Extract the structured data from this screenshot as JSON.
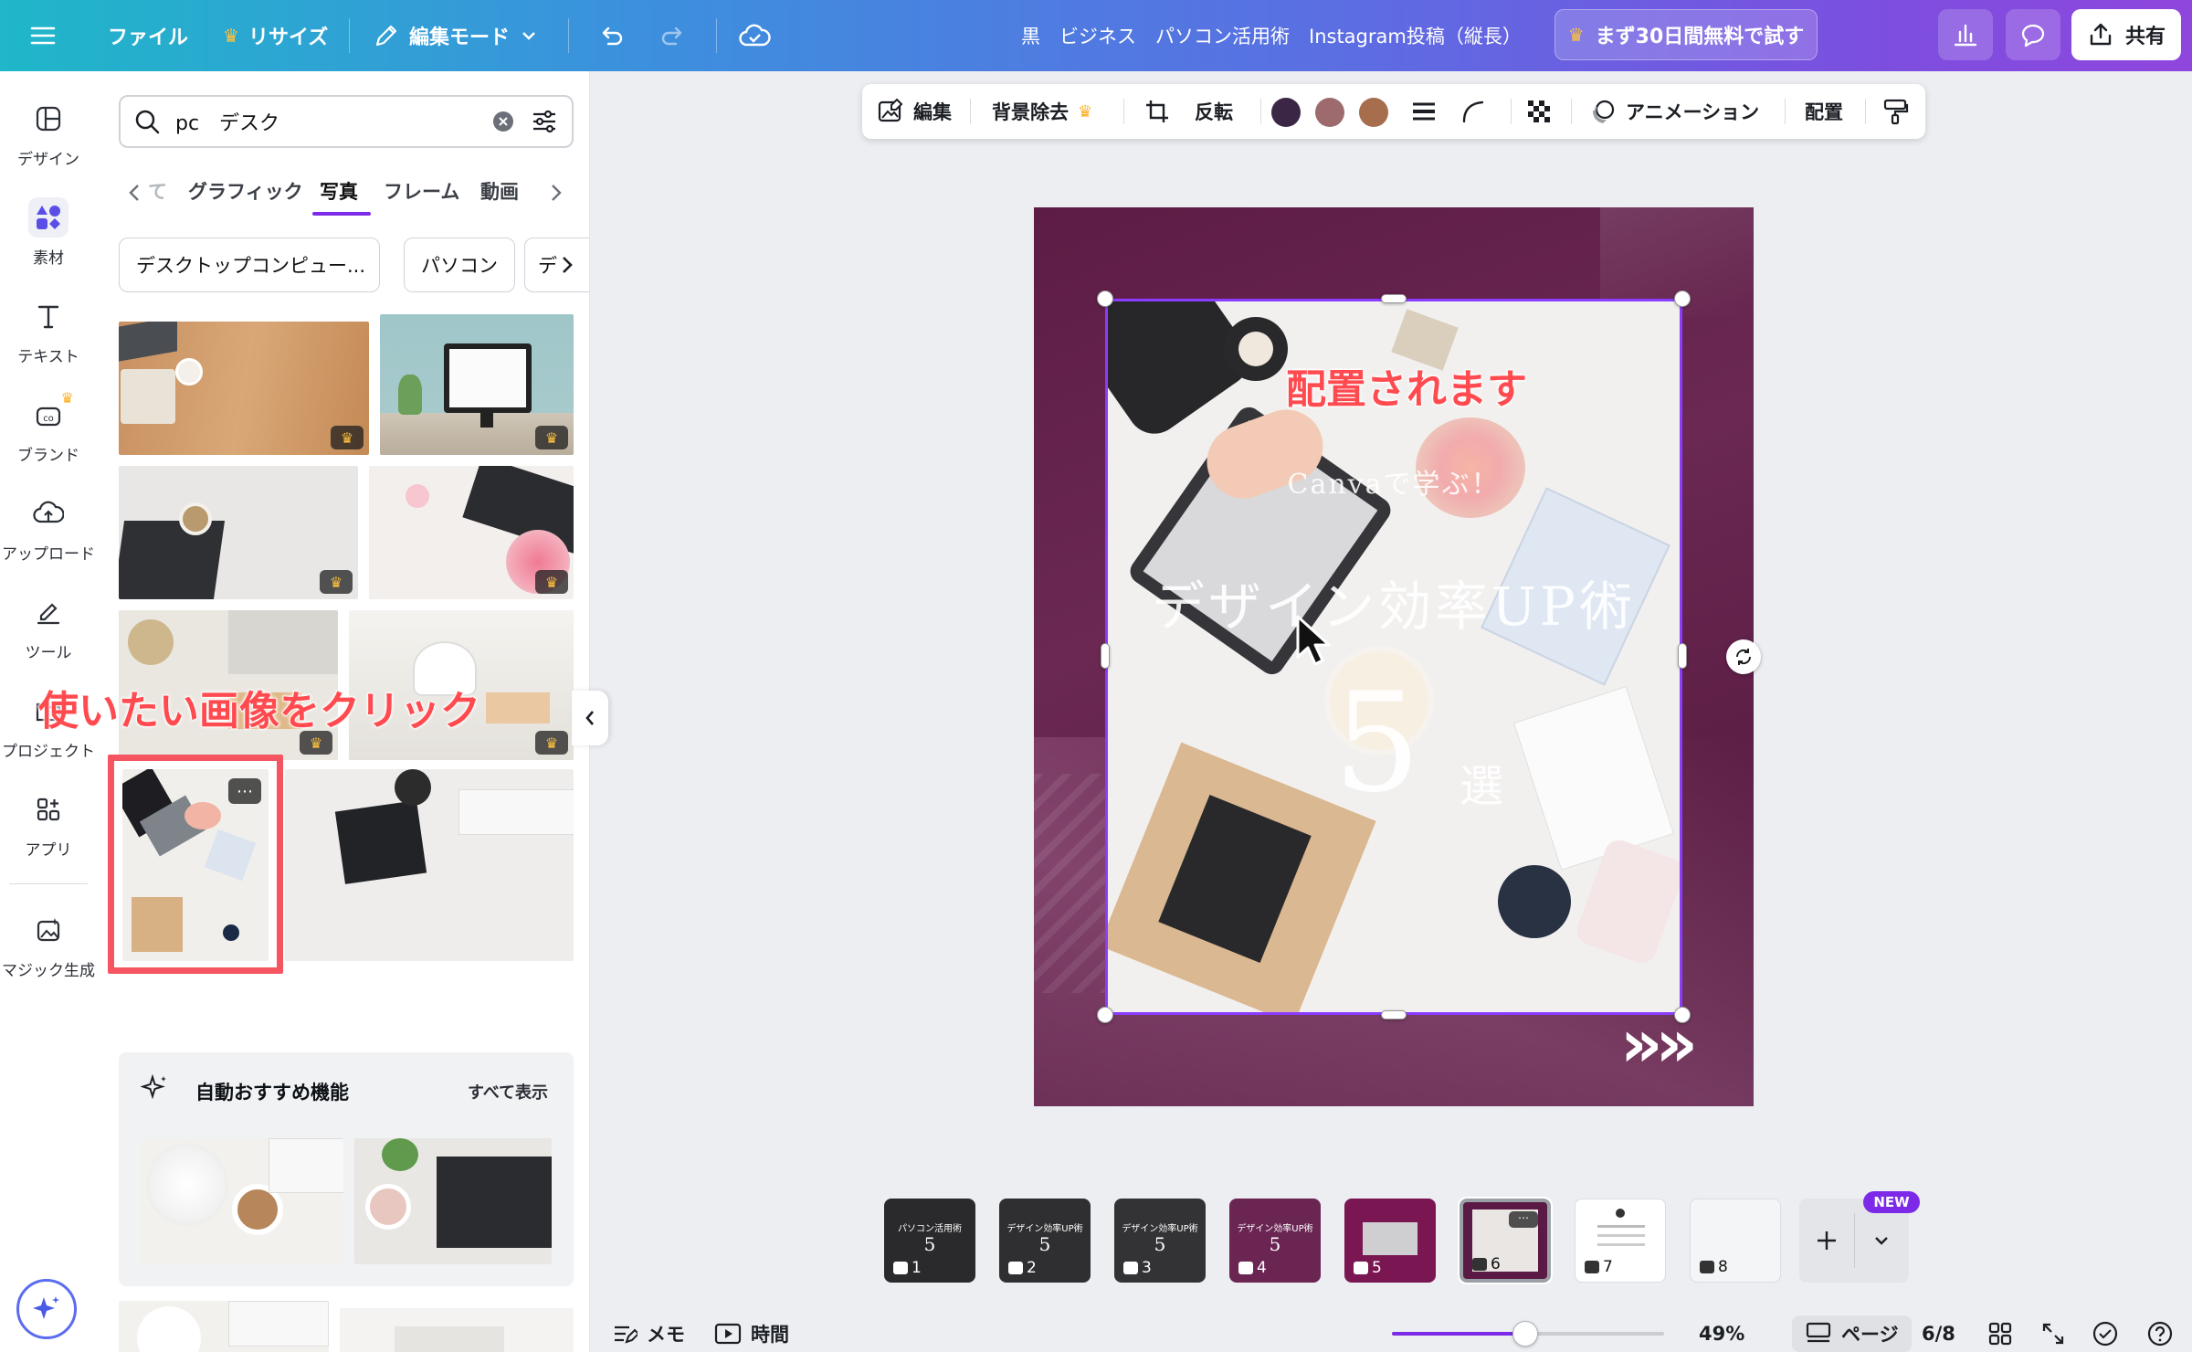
{
  "topbar": {
    "file": "ファイル",
    "resize": "リサイズ",
    "edit_mode": "編集モード",
    "doc_title": "黒　ビジネス　パソコン活用術　Instagram投稿（縦長）",
    "trial": "まず30日間無料で試す",
    "share": "共有"
  },
  "rail": {
    "design": "デザイン",
    "elements": "素材",
    "text": "テキスト",
    "brand": "ブランド",
    "upload": "アップロード",
    "tools": "ツール",
    "projects": "プロジェクト",
    "apps": "アプリ",
    "magic": "マジック生成"
  },
  "panel": {
    "search_value": "pc　デスク",
    "tabs": [
      "て",
      "グラフィック",
      "写真",
      "フレーム",
      "動画"
    ],
    "chips": [
      "デスクトップコンピュー...",
      "パソコン",
      "デ"
    ],
    "rec_title": "自動おすすめ機能",
    "rec_all": "すべて表示"
  },
  "floatbar": {
    "edit": "編集",
    "bg_remove": "背景除去",
    "flip": "反転",
    "animation": "アニメーション",
    "position": "配置",
    "colors": [
      "#3b2646",
      "#9d6b6e",
      "#a66e4d"
    ]
  },
  "canvas": {
    "subtitle": "Canvaで学ぶ！",
    "title": "デザイン効率UP術",
    "number": "5",
    "unit": "選",
    "arrows": "»»",
    "annot_placed": "配置されます",
    "annot_click": "使いたい画像をクリック"
  },
  "pages": {
    "items": [
      "1",
      "2",
      "3",
      "4",
      "5",
      "6",
      "7",
      "8"
    ],
    "new_badge": "NEW",
    "thumb_title": "パソコン活用術",
    "thumb_title2": "デザイン効率UP術",
    "thumb_num": "5"
  },
  "bottombar": {
    "memo": "メモ",
    "time": "時間",
    "zoom": "49%",
    "zoom_level": 0.49,
    "pages_label": "ページ",
    "page_count": "6/8"
  }
}
